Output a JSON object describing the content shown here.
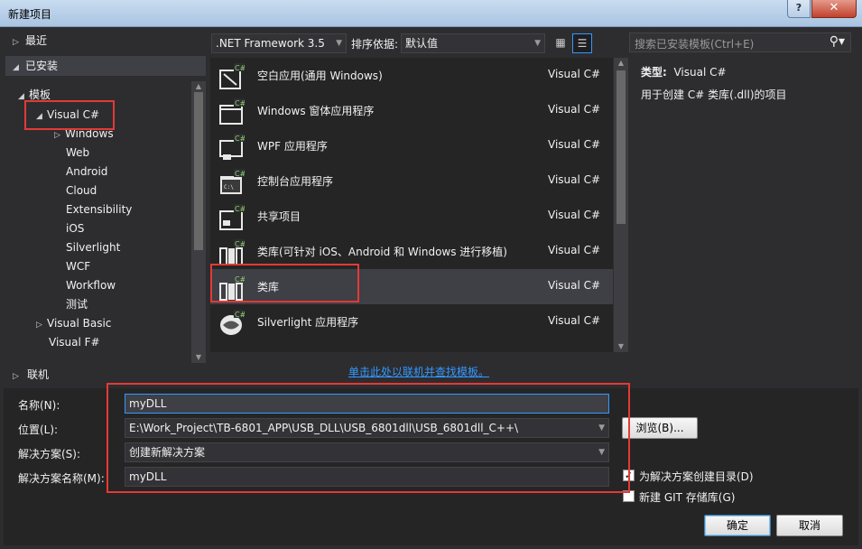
{
  "window": {
    "title": "新建项目",
    "help_label": "?",
    "close_label": "✕"
  },
  "sidebar": {
    "recent": "最近",
    "installed": "已安装",
    "templates": "模板",
    "items": [
      {
        "label": "Visual C#"
      },
      {
        "label": "Windows"
      },
      {
        "label": "Web"
      },
      {
        "label": "Android"
      },
      {
        "label": "Cloud"
      },
      {
        "label": "Extensibility"
      },
      {
        "label": "iOS"
      },
      {
        "label": "Silverlight"
      },
      {
        "label": "WCF"
      },
      {
        "label": "Workflow"
      },
      {
        "label": "测试"
      },
      {
        "label": "Visual Basic"
      },
      {
        "label": "Visual F#"
      }
    ],
    "online": "联机"
  },
  "toolbar": {
    "framework": ".NET Framework 3.5",
    "sort_label": "排序依据:",
    "sort_value": "默认值"
  },
  "templates": [
    {
      "name": "空白应用(通用 Windows)",
      "lang": "Visual C#"
    },
    {
      "name": "Windows 窗体应用程序",
      "lang": "Visual C#"
    },
    {
      "name": "WPF 应用程序",
      "lang": "Visual C#"
    },
    {
      "name": "控制台应用程序",
      "lang": "Visual C#"
    },
    {
      "name": "共享项目",
      "lang": "Visual C#"
    },
    {
      "name": "类库(可针对 iOS、Android 和 Windows 进行移植)",
      "lang": "Visual C#"
    },
    {
      "name": "类库",
      "lang": "Visual C#"
    },
    {
      "name": "Silverlight 应用程序",
      "lang": "Visual C#"
    }
  ],
  "online_link": "单击此处以联机并查找模板。",
  "search": {
    "placeholder": "搜索已安装模板(Ctrl+E)"
  },
  "info": {
    "type_label": "类型:",
    "type_value": "Visual C#",
    "description": "用于创建 C# 类库(.dll)的项目"
  },
  "form": {
    "name_label": "名称(N):",
    "name_value": "myDLL",
    "location_label": "位置(L):",
    "location_value": "E:\\Work_Project\\TB-6801_APP\\USB_DLL\\USB_6801dll\\USB_6801dll_C++\\",
    "solution_label": "解决方案(S):",
    "solution_value": "创建新解决方案",
    "solution_name_label": "解决方案名称(M):",
    "solution_name_value": "myDLL",
    "browse_label": "浏览(B)...",
    "create_dir_label": "为解决方案创建目录(D)",
    "create_dir_checked": true,
    "git_label": "新建 GIT 存储库(G)",
    "git_checked": false,
    "ok_label": "确定",
    "cancel_label": "取消"
  }
}
